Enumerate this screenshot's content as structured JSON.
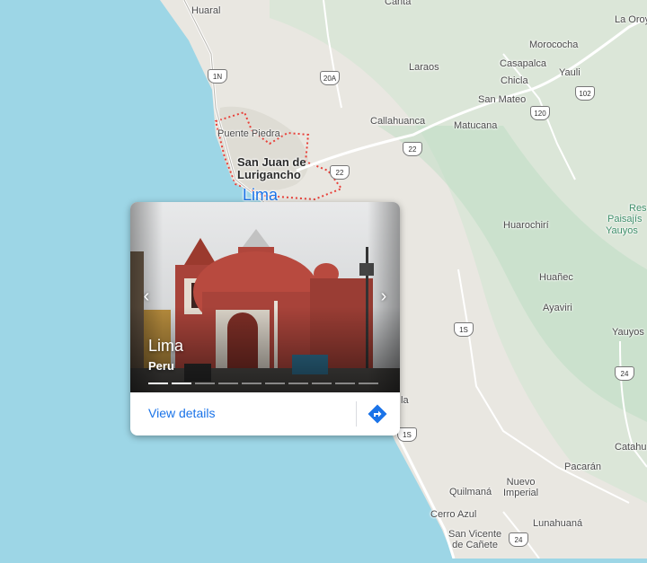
{
  "map": {
    "labels": {
      "huaral": "Huaral",
      "canta": "Canta",
      "la_oroya": "La Oroy",
      "morococha": "Morococha",
      "laraos": "Laraos",
      "casapalca": "Casapalca",
      "yauli": "Yauli",
      "chicla": "Chicla",
      "san_mateo": "San Mateo",
      "callahuanca": "Callahuanca",
      "matucana": "Matucana",
      "puente_piedra": "Puente Piedra",
      "san_juan": "San Juan de\nLurigancho",
      "lima": "Lima",
      "res": "Res",
      "paisajis": "Paisajís",
      "yauyos_park": "Yauyos",
      "huarochiri": "Huarochirí",
      "huanec": "Huañec",
      "ayaviri": "Ayaviri",
      "yauyos": "Yauyos",
      "la": "la",
      "catahu": "Catahu",
      "pacaran": "Pacarán",
      "nuevo_imperial": "Nuevo\nImperial",
      "quilmana": "Quilmaná",
      "cerro_azul": "Cerro Azul",
      "lunahuana": "Lunahuaná",
      "san_vicente": "San Vicente\nde Cañete"
    },
    "shields": {
      "s1n": "1N",
      "s20a": "20A",
      "s102": "102",
      "s120": "120",
      "s22a": "22",
      "s22b": "22",
      "s1s_a": "1S",
      "s1s_b": "1S",
      "s24a": "24",
      "s24b": "24"
    },
    "colors": {
      "water": "#9dd6e6",
      "land": "#e9e7e1",
      "terrain": "#cfe6d1",
      "road": "#ffffff",
      "boundary": "#e8413a",
      "accent": "#1a73e8"
    }
  },
  "card": {
    "title": "Lima",
    "subtitle": "Peru",
    "view_details": "View details",
    "photo_count": 10,
    "active_index": 1,
    "prev_icon": "‹",
    "next_icon": "›"
  }
}
